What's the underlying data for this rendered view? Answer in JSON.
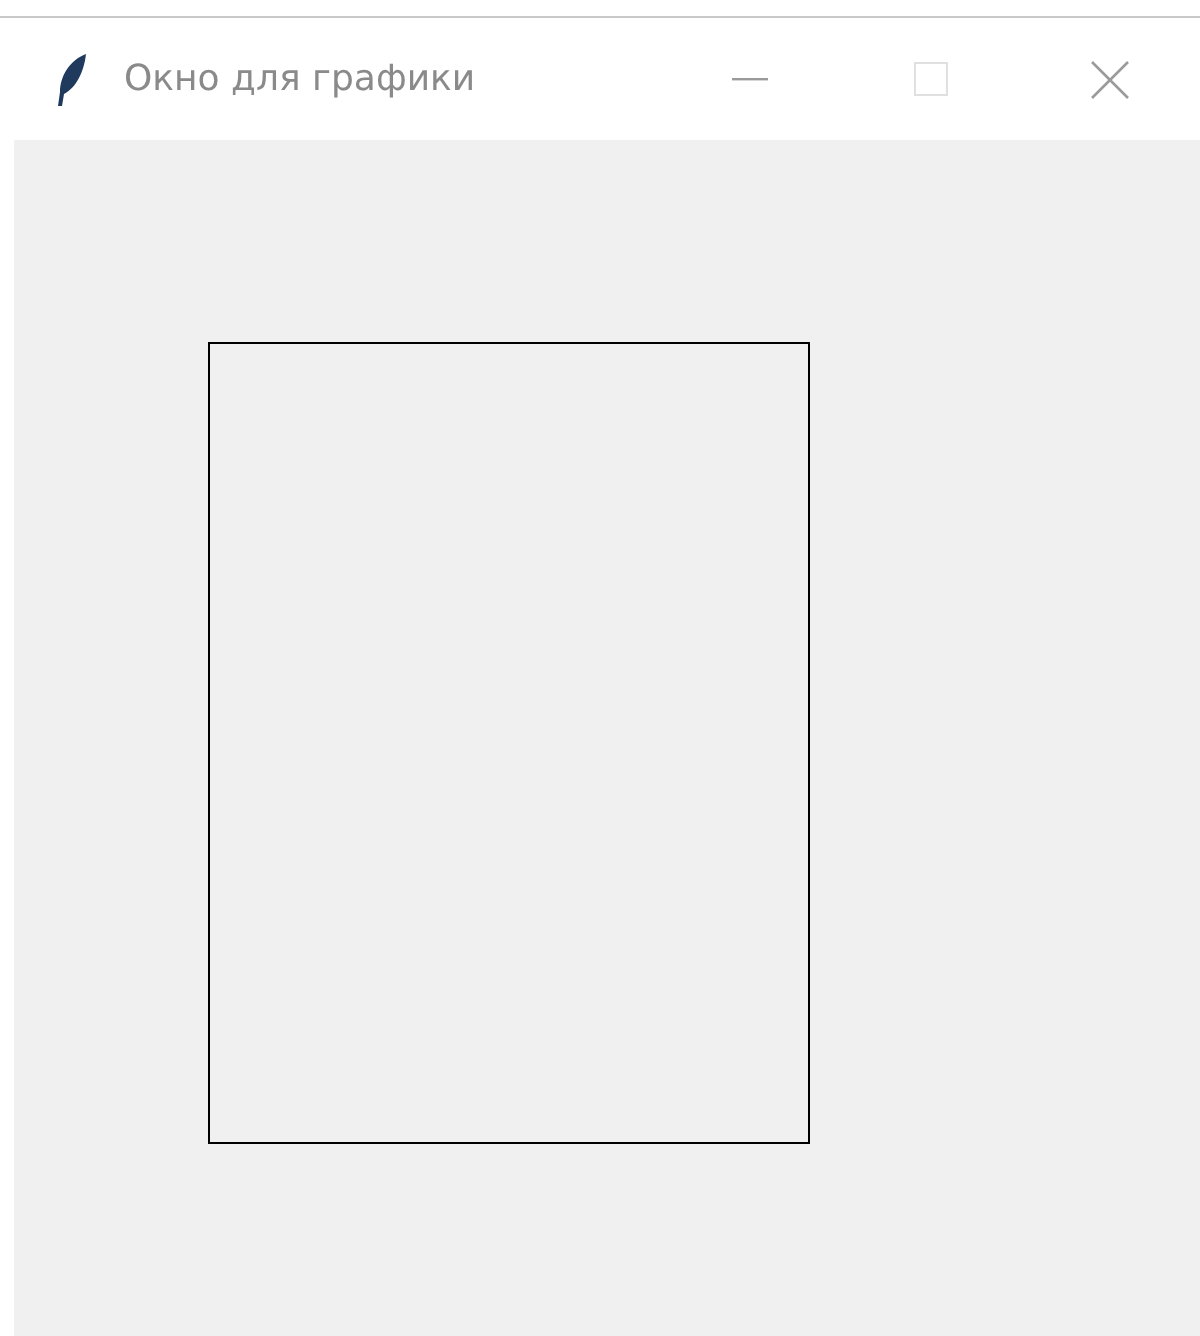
{
  "window": {
    "title": "Окно для графики",
    "active": false,
    "maximize_disabled": true
  }
}
